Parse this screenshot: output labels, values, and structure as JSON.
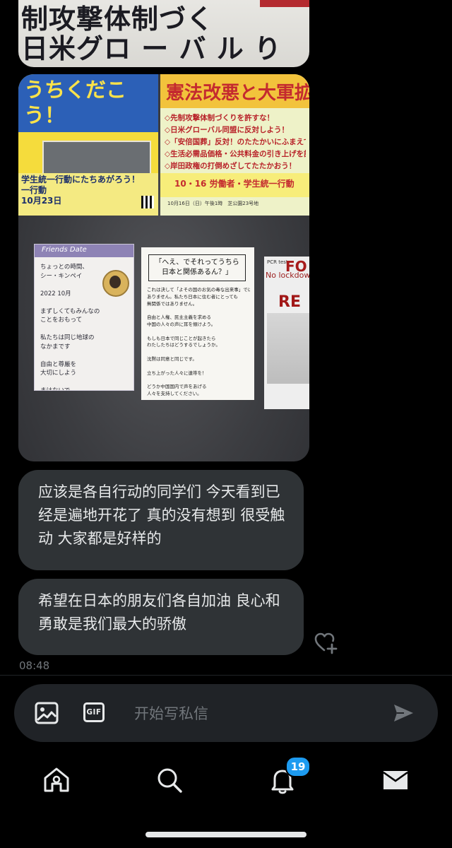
{
  "media_top": {
    "banner_text_line1": "制攻撃体制づく",
    "banner_text_line2": "日米グロ ー バ ル  り"
  },
  "photo": {
    "left_poster": {
      "headline": "うちくだこう！",
      "footer": "学生統一行動にたちあがろう！\n一行動\n10月23日"
    },
    "right_poster": {
      "headline": "憲法改悪と大軍拡を",
      "lines": "◇先制攻撃体制づくりを許すな！\n◇日米グローバル同盟に反対しよう！\n◇「安倍国葬」反対！のたたかいにふまえて\n◇生活必需品価格・公共料金の引き上げを許すな！\n◇岸田政権の打倒めざしてたたかおう！",
      "strip": "10・16 労働者・学生統一行動",
      "strip_sub": "10月16日（日）午後1時　芝公園23号地"
    },
    "sheet_a": {
      "tab": "Friends Date",
      "handwriting": "ちょっとの時間、\nシー・キンペイ\n\n2022 10月\n\nまずしくてもみんなの\nことをおもって\n\n私たちは同じ地球の\nなかまです\n\n自由と尊厳を\n大切にしよう\n\nまけないで\n\nゆうき！がんばれ"
    },
    "sheet_b": {
      "title": "「へえ、でそれってうちら\n日本と関係あるん？」",
      "body": "これは決して「よその国のお気の毒な出来事」では\nありません。私たち日本に住む者にとっても\n無関係ではありません。\n\n自由と人権、民主主義を求める\n中国の人々の声に耳を傾けよう。\n\nもしも日本で同じことが起きたら\nわたしたちはどうするでしょうか。\n\n沈黙は同意と同じです。\n\n立ち上がった人々に連帯を！\n\nどうか中国国内で声をあげる\n人々を支持してください。"
    },
    "sheet_c": {
      "title": "PCR test",
      "big": "FO",
      "sub": "No lockdown",
      "red": "RE"
    }
  },
  "messages": [
    {
      "text": "应该是各自行动的同学们 今天看到已经是遍地开花了 真的没有想到 很受触动 大家都是好样的"
    },
    {
      "text": "希望在日本的朋友们各自加油 良心和勇敢是我们最大的骄傲"
    }
  ],
  "timestamp": "08:48",
  "composer": {
    "placeholder": "开始写私信",
    "gif_label": "GIF"
  },
  "nav": {
    "notifications_badge": "19"
  },
  "icons": {
    "image": "image-icon",
    "gif": "gif-icon",
    "send": "send-icon",
    "react": "heart-plus-icon",
    "home": "home-icon",
    "search": "search-icon",
    "notifications": "bell-icon",
    "messages": "envelope-icon"
  },
  "colors": {
    "bubble": "#2f3336",
    "accent": "#1d9bf0",
    "muted": "#71767b"
  }
}
